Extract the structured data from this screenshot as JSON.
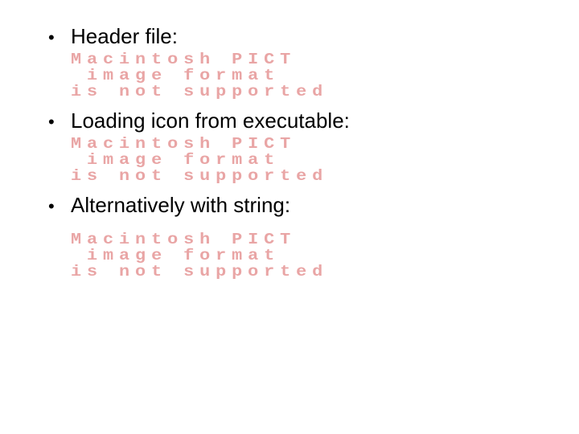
{
  "bullets": [
    {
      "label": "Header file:"
    },
    {
      "label": "Loading icon from executable:"
    },
    {
      "label": "Alternatively with string:"
    }
  ],
  "pict_error": {
    "line1": "Macintosh PICT",
    "line2": "image format",
    "line3": "is not supported"
  },
  "bullet_char": "•"
}
